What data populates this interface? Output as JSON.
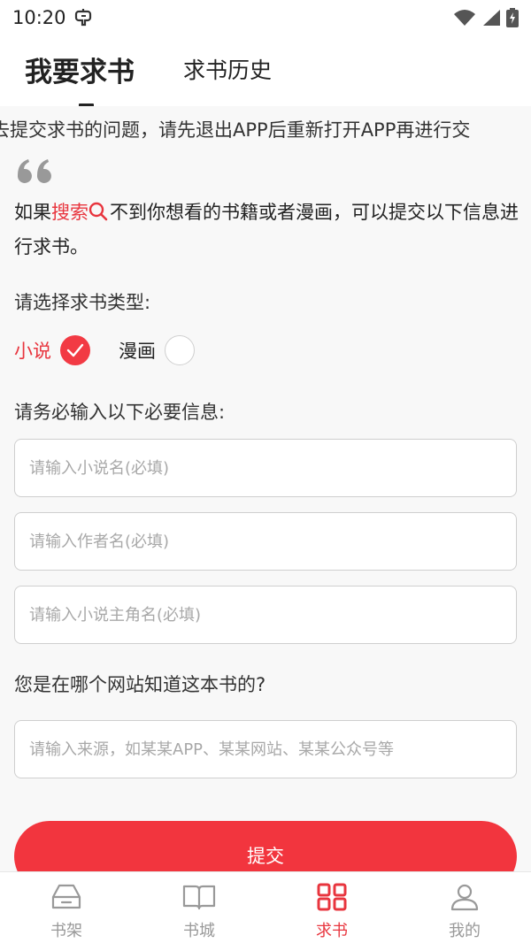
{
  "status_bar": {
    "time": "10:20",
    "app_icon": "bug-icon",
    "icons": [
      "wifi-icon",
      "signal-icon",
      "battery-charging-icon"
    ]
  },
  "tabs": [
    {
      "label": "我要求书",
      "active": true
    },
    {
      "label": "求书历史",
      "active": false
    }
  ],
  "marquee": {
    "text": "去提交求书的问题，请先退出APP后重新打开APP再进行交"
  },
  "intro": {
    "prefix": "如果",
    "highlight": "搜索",
    "suffix": "不到你想看的书籍或者漫画，可以提交以下信息进行求书。"
  },
  "type_section": {
    "label": "请选择求书类型:",
    "options": [
      {
        "label": "小说",
        "selected": true
      },
      {
        "label": "漫画",
        "selected": false
      }
    ]
  },
  "required_section": {
    "label": "请务必输入以下必要信息:",
    "fields": [
      {
        "placeholder": "请输入小说名(必填)",
        "value": ""
      },
      {
        "placeholder": "请输入作者名(必填)",
        "value": ""
      },
      {
        "placeholder": "请输入小说主角名(必填)",
        "value": ""
      }
    ]
  },
  "source_section": {
    "label": "您是在哪个网站知道这本书的?",
    "field": {
      "placeholder": "请输入来源，如某某APP、某某网站、某某公众号等",
      "value": ""
    }
  },
  "submit": {
    "label": "提交"
  },
  "bottom_nav": [
    {
      "label": "书架",
      "icon": "bookshelf-icon",
      "active": false
    },
    {
      "label": "书城",
      "icon": "open-book-icon",
      "active": false
    },
    {
      "label": "求书",
      "icon": "grid-icon",
      "active": true
    },
    {
      "label": "我的",
      "icon": "user-icon",
      "active": false
    }
  ],
  "colors": {
    "accent": "#e8353e",
    "button": "#f2353e",
    "inactive": "#999999",
    "background": "#f8f8f8"
  }
}
